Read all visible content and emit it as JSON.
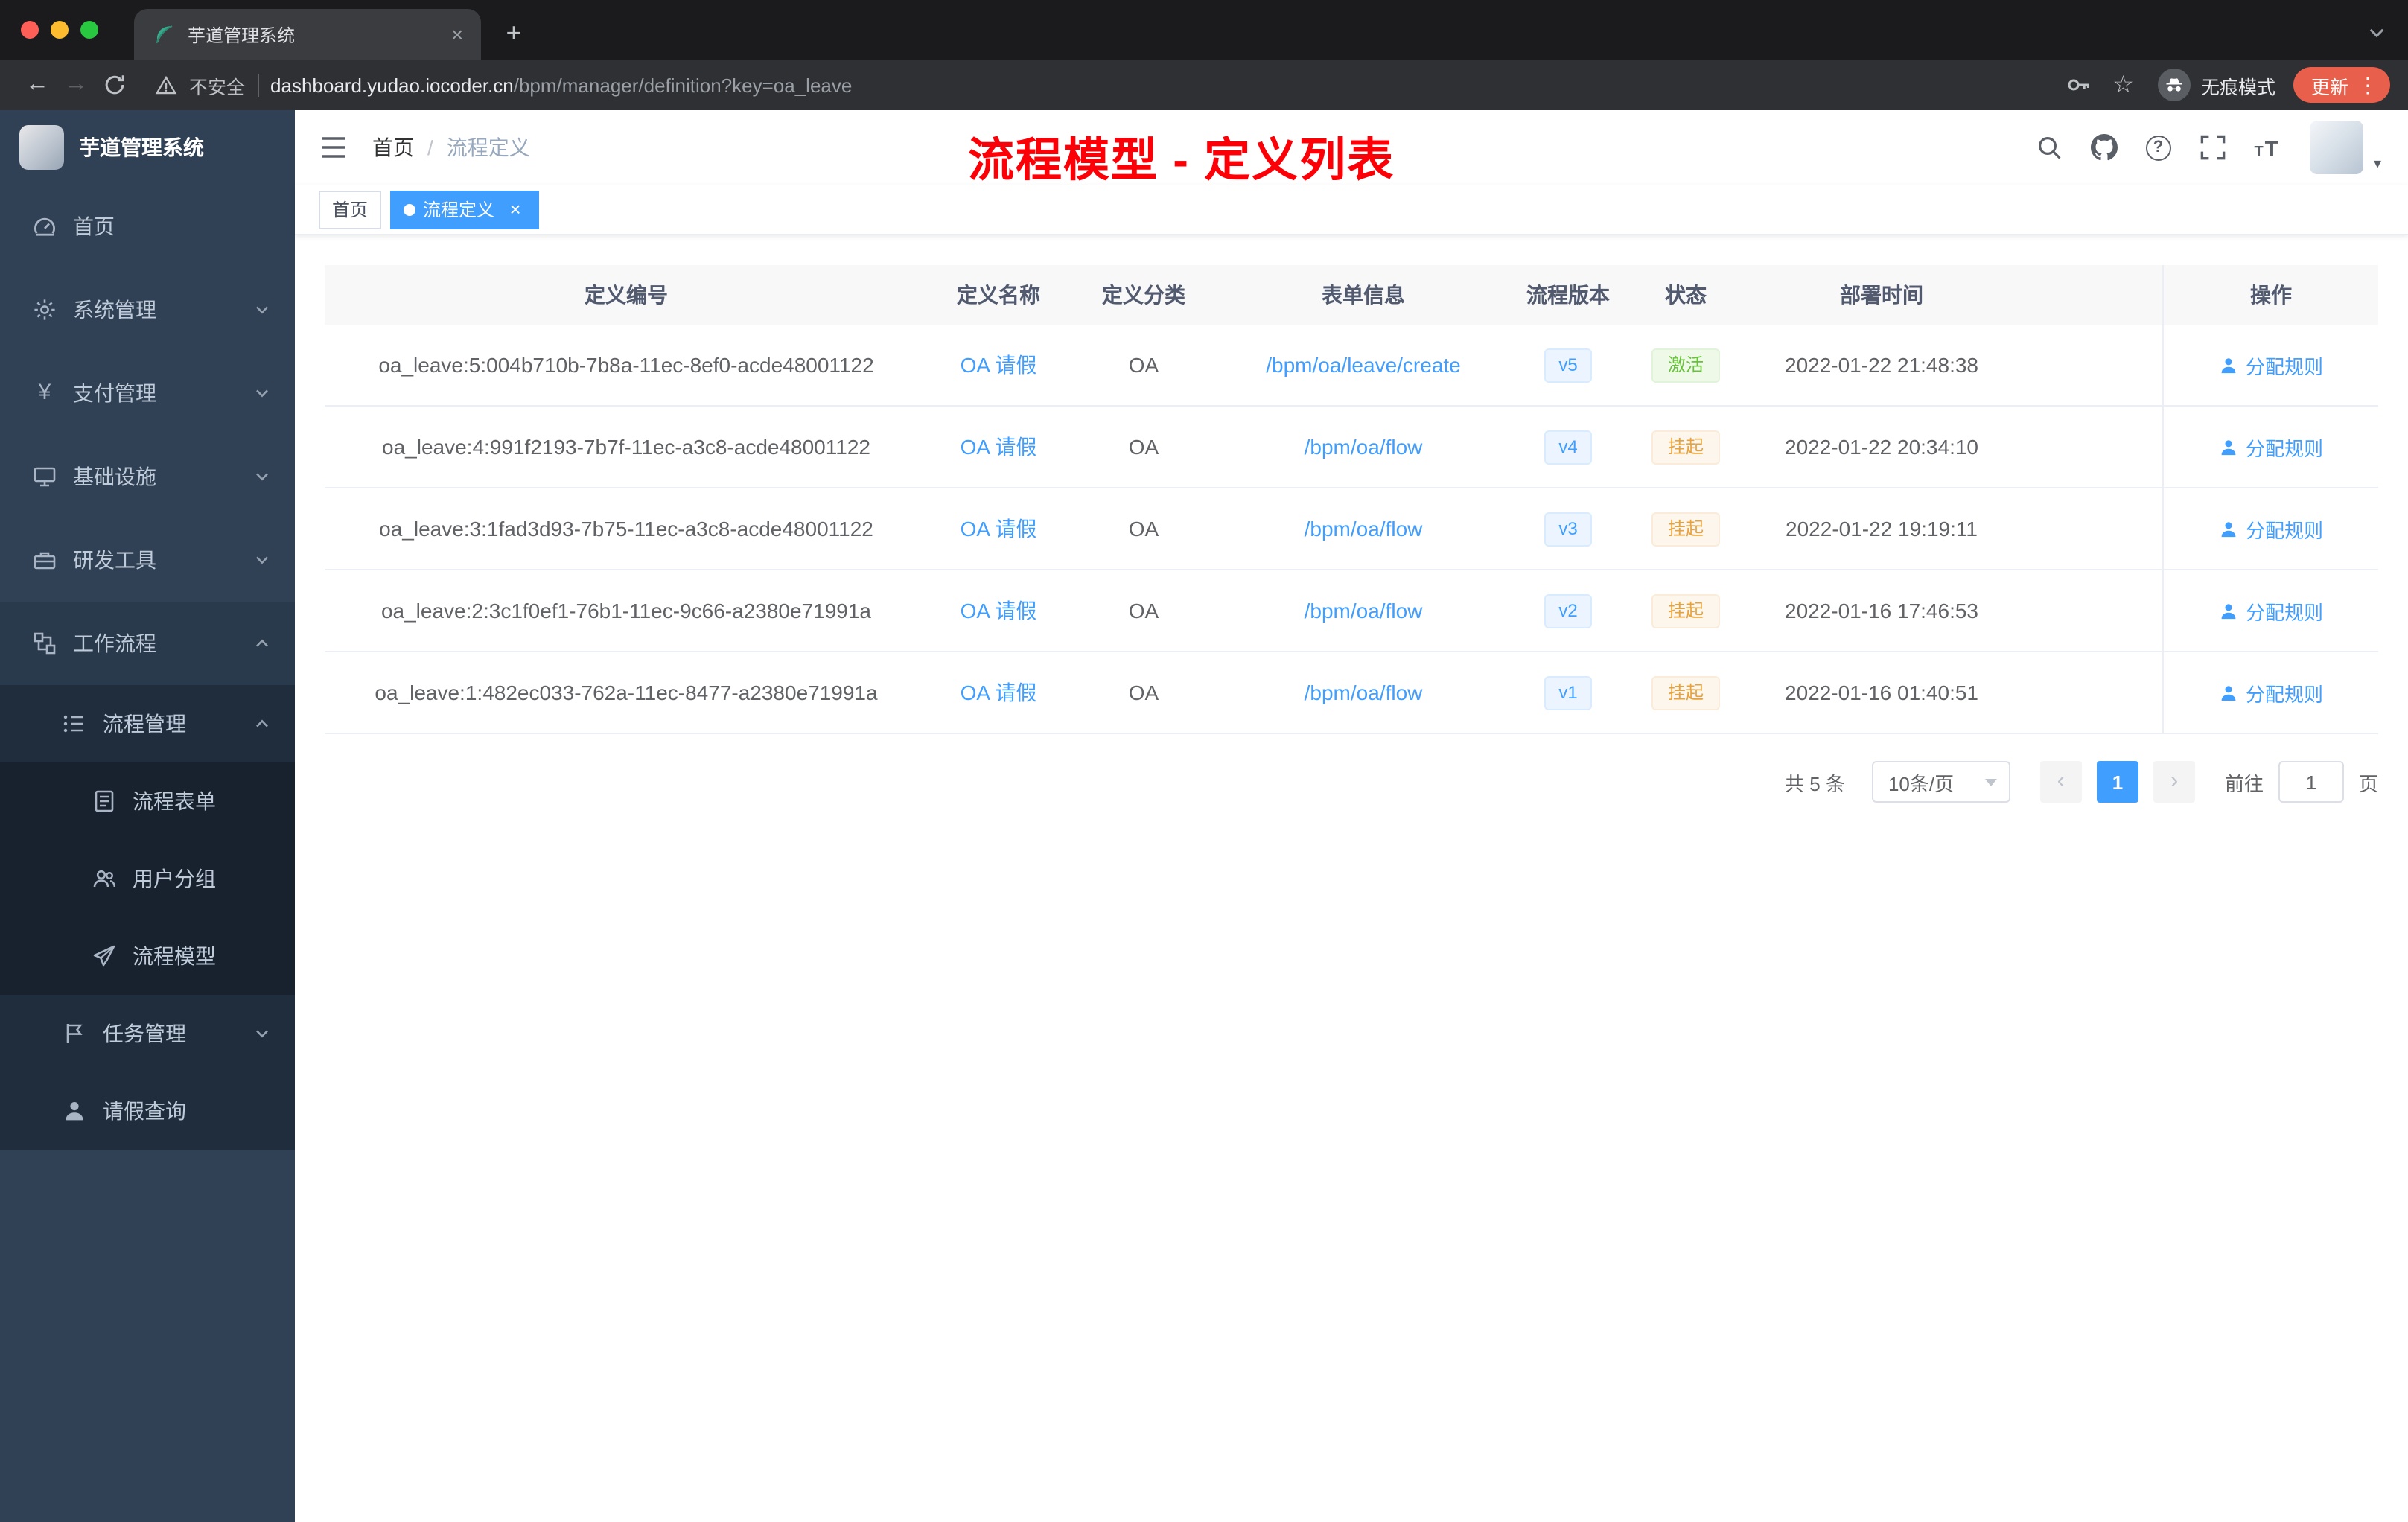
{
  "colors": {
    "accent": "#409EFF",
    "success": "#67C23A",
    "warning": "#E6A23C",
    "annotation_red": "#FB0007",
    "sidebar_bg": "#304156"
  },
  "browser": {
    "tab_title": "芋道管理系统",
    "security_label": "不安全",
    "url_host": "dashboard.yudao.iocoder.cn",
    "url_path": "/bpm/manager/definition?key=oa_leave",
    "incognito_label": "无痕模式",
    "update_label": "更新"
  },
  "icons": {
    "close": "×",
    "new_tab": "+",
    "back": "←",
    "forward": "→",
    "star": "☆",
    "overflow": "⋮",
    "question": "?",
    "caret": "▾",
    "prev": "‹",
    "next": "›",
    "breadcrumb_sep": "/",
    "yen": "¥",
    "font_small": "T",
    "font_large": "T"
  },
  "sidebar": {
    "logo_title": "芋道管理系统",
    "items": [
      {
        "label": "首页"
      },
      {
        "label": "系统管理"
      },
      {
        "label": "支付管理"
      },
      {
        "label": "基础设施"
      },
      {
        "label": "研发工具"
      },
      {
        "label": "工作流程"
      },
      {
        "label": "流程管理"
      },
      {
        "label": "流程表单"
      },
      {
        "label": "用户分组"
      },
      {
        "label": "流程模型"
      },
      {
        "label": "任务管理"
      },
      {
        "label": "请假查询"
      }
    ]
  },
  "header": {
    "breadcrumb_home": "首页",
    "breadcrumb_current": "流程定义",
    "annotation": "流程模型 - 定义列表"
  },
  "tags": {
    "home": "首页",
    "active": "流程定义"
  },
  "table": {
    "columns": [
      "定义编号",
      "定义名称",
      "定义分类",
      "表单信息",
      "流程版本",
      "状态",
      "部署时间",
      "操作"
    ],
    "rows": [
      {
        "id": "oa_leave:5:004b710b-7b8a-11ec-8ef0-acde48001122",
        "name": "OA 请假",
        "category": "OA",
        "form": "/bpm/oa/leave/create",
        "version": "v5",
        "status": "激活",
        "status_type": "success",
        "time": "2022-01-22 21:48:38",
        "action": "分配规则"
      },
      {
        "id": "oa_leave:4:991f2193-7b7f-11ec-a3c8-acde48001122",
        "name": "OA 请假",
        "category": "OA",
        "form": "/bpm/oa/flow",
        "version": "v4",
        "status": "挂起",
        "status_type": "warning",
        "time": "2022-01-22 20:34:10",
        "action": "分配规则"
      },
      {
        "id": "oa_leave:3:1fad3d93-7b75-11ec-a3c8-acde48001122",
        "name": "OA 请假",
        "category": "OA",
        "form": "/bpm/oa/flow",
        "version": "v3",
        "status": "挂起",
        "status_type": "warning",
        "time": "2022-01-22 19:19:11",
        "action": "分配规则"
      },
      {
        "id": "oa_leave:2:3c1f0ef1-76b1-11ec-9c66-a2380e71991a",
        "name": "OA 请假",
        "category": "OA",
        "form": "/bpm/oa/flow",
        "version": "v2",
        "status": "挂起",
        "status_type": "warning",
        "time": "2022-01-16 17:46:53",
        "action": "分配规则"
      },
      {
        "id": "oa_leave:1:482ec033-762a-11ec-8477-a2380e71991a",
        "name": "OA 请假",
        "category": "OA",
        "form": "/bpm/oa/flow",
        "version": "v1",
        "status": "挂起",
        "status_type": "warning",
        "time": "2022-01-16 01:40:51",
        "action": "分配规则"
      }
    ]
  },
  "pagination": {
    "total": "共 5 条",
    "page_size": "10条/页",
    "current_page": "1",
    "goto_label": "前往",
    "goto_value": "1",
    "page_unit": "页"
  }
}
